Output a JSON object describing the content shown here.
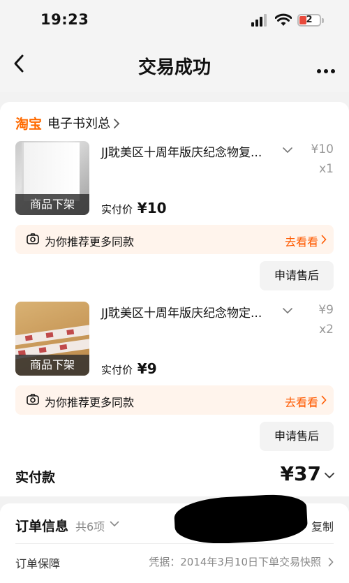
{
  "status_bar": {
    "time": "19:23",
    "battery": "2"
  },
  "nav": {
    "title": "交易成功"
  },
  "shop": {
    "logo": "淘宝",
    "name": "电子书刘总"
  },
  "items": [
    {
      "title": "JJ耽美区十周年版庆纪念物复...",
      "price": "¥10",
      "qty": "x1",
      "paid_label": "实付价",
      "paid_value": "¥10",
      "status": "商品下架",
      "recommend_text": "为你推荐更多同款",
      "recommend_link": "去看看",
      "after_sale": "申请售后"
    },
    {
      "title": "JJ耽美区十周年版庆纪念物定...",
      "price": "¥9",
      "qty": "x2",
      "paid_label": "实付价",
      "paid_value": "¥9",
      "status": "商品下架",
      "recommend_text": "为你推荐更多同款",
      "recommend_link": "去看看",
      "after_sale": "申请售后"
    }
  ],
  "total": {
    "label": "实付款",
    "value": "¥37"
  },
  "order_info": {
    "title": "订单信息",
    "count": "共6项",
    "copy": "复制",
    "guarantee_label": "订单保障",
    "guarantee_value": "凭据：2014年3月10日下单交易快照"
  },
  "colors": {
    "accent": "#ff6a00",
    "link": "#ff5a00",
    "recommend_bg": "#fff4ec"
  }
}
